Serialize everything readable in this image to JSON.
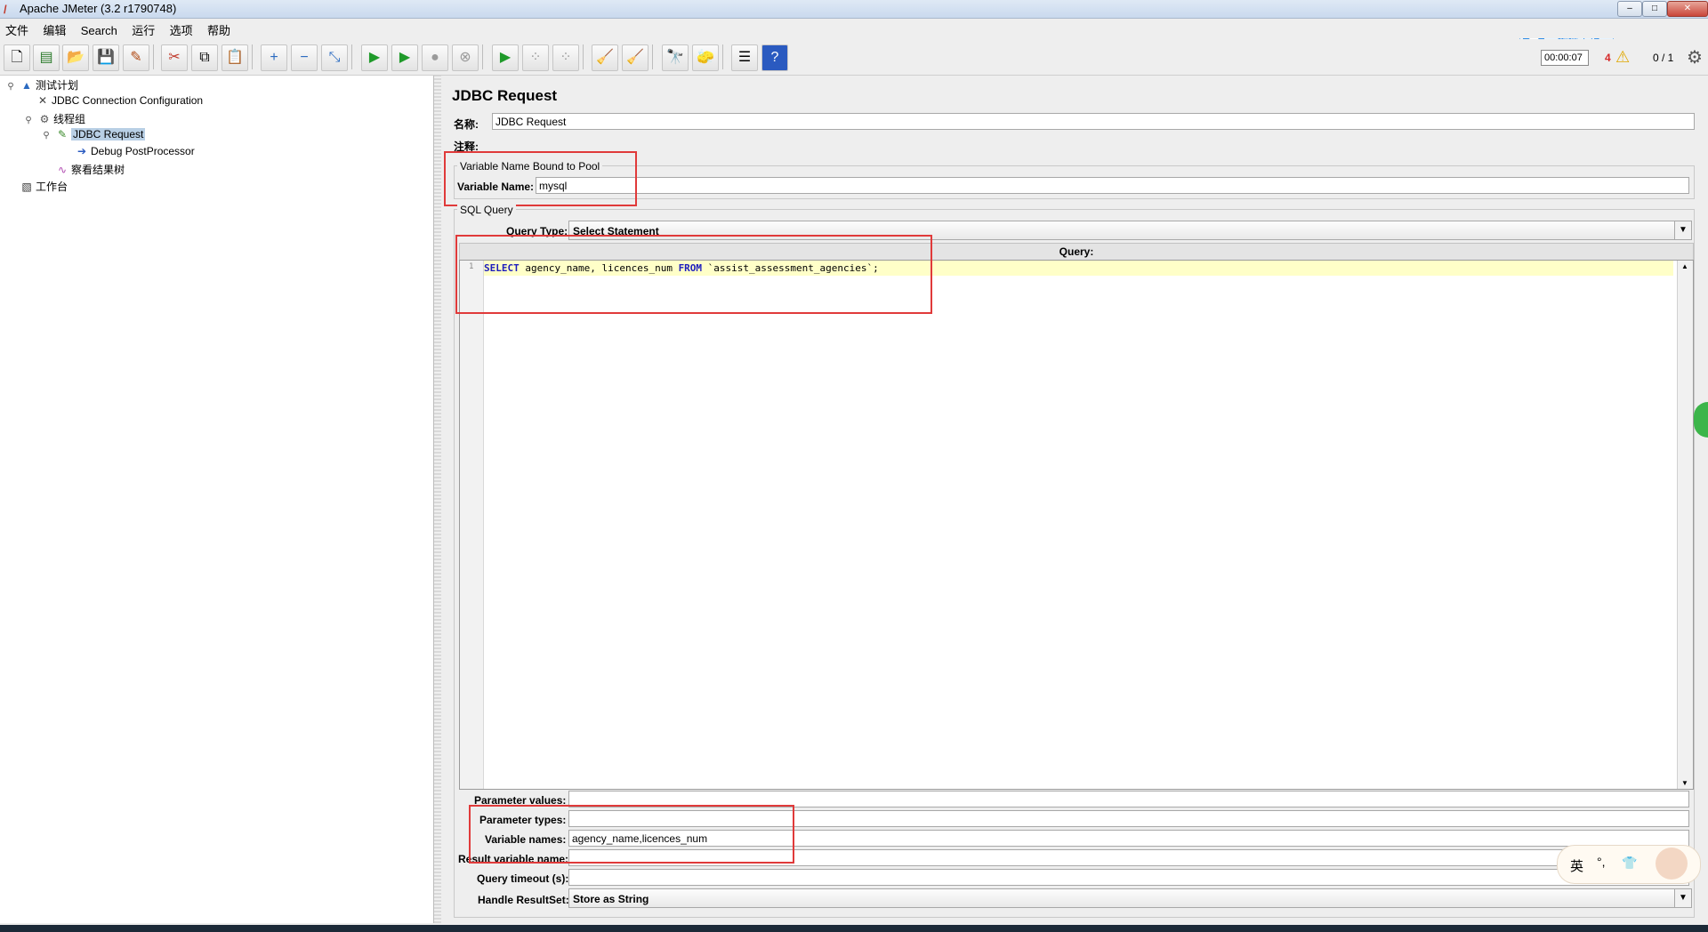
{
  "window": {
    "title": "Apache JMeter (3.2 r1790748)"
  },
  "menu": [
    "文件",
    "编辑",
    "Search",
    "运行",
    "选项",
    "帮助"
  ],
  "toolbar": {
    "timer": "00:00:07",
    "warnings": "4",
    "threads": "0 / 1"
  },
  "upload_button": "拖拽上传",
  "tree": {
    "items": [
      {
        "label": "测试计划"
      },
      {
        "label": "JDBC Connection Configuration"
      },
      {
        "label": "线程组"
      },
      {
        "label": "JDBC Request"
      },
      {
        "label": "Debug PostProcessor"
      },
      {
        "label": "察看结果树"
      },
      {
        "label": "工作台"
      }
    ]
  },
  "panel": {
    "title": "JDBC Request",
    "name_label": "名称:",
    "name_value": "JDBC Request",
    "comment_label": "注释:",
    "pool_group": "Variable Name Bound to Pool",
    "variable_name_label": "Variable Name:",
    "variable_name_value": "mysql",
    "sql_group": "SQL Query",
    "query_type_label": "Query Type:",
    "query_type_value": "Select Statement",
    "query_header": "Query:",
    "line_number": "1",
    "code": {
      "kw1": "SELECT",
      "mid": " agency_name, licences_num ",
      "kw2": "FROM",
      "rest": " `assist_assessment_agencies`;"
    },
    "parameter_values_label": "Parameter values:",
    "parameter_values": "",
    "parameter_types_label": "Parameter types:",
    "parameter_types": "",
    "variable_names_label": "Variable names:",
    "variable_names": "agency_name,licences_num",
    "result_variable_label": "Result variable name:",
    "result_variable": "",
    "query_timeout_label": "Query timeout (s):",
    "query_timeout": "",
    "handle_resultset_label": "Handle ResultSet:",
    "handle_resultset_value": "Store as String"
  },
  "ime": {
    "lang": "英",
    "punct": "°,"
  }
}
